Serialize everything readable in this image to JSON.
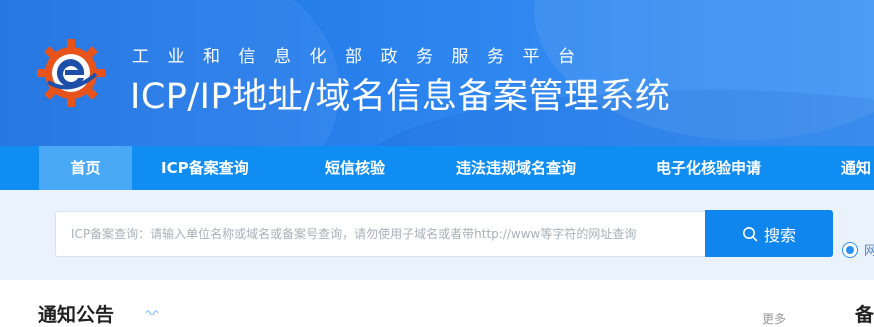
{
  "header": {
    "subtitle": "工业和信息化部政务服务平台",
    "title": "ICP/IP地址/域名信息备案管理系统"
  },
  "nav": {
    "items": [
      {
        "label": "首页",
        "active": true
      },
      {
        "label": "ICP备案查询"
      },
      {
        "label": "短信核验"
      },
      {
        "label": "违法违规域名查询"
      },
      {
        "label": "电子化核验申请"
      },
      {
        "label": "通知"
      }
    ]
  },
  "search": {
    "placeholder": "ICP备案查询：请输入单位名称或域名或备案号查询，请勿使用子域名或者带http://www等字符的网址查询",
    "button_label": "搜索",
    "option_label": "网"
  },
  "notice": {
    "title": "通知公告",
    "more_label": "更多",
    "side_title": "备"
  },
  "colors": {
    "banner": "#2a82ee",
    "nav": "#0f8df2",
    "nav_active": "#4aa9f7",
    "search_bg": "#eaf3fd",
    "button": "#0f86ee"
  }
}
